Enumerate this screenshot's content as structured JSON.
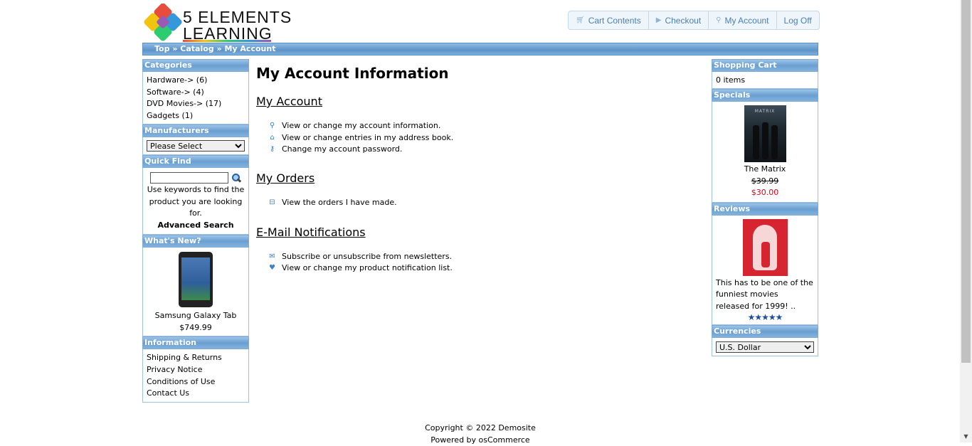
{
  "header": {
    "logo_line1": "5 ELEMENTS",
    "logo_line2": "LEARNING",
    "nav": {
      "cart_contents": "Cart Contents",
      "checkout": "Checkout",
      "my_account": "My Account",
      "log_off": "Log Off"
    }
  },
  "breadcrumb": {
    "top": "Top",
    "sep": "»",
    "catalog": "Catalog",
    "my_account": "My Account"
  },
  "left": {
    "categories": {
      "title": "Categories",
      "items": [
        "Hardware-> (6)",
        "Software-> (4)",
        "DVD Movies-> (17)",
        "Gadgets (1)"
      ]
    },
    "manufacturers": {
      "title": "Manufacturers",
      "selected": "Please Select"
    },
    "quick_find": {
      "title": "Quick Find",
      "help": "Use keywords to find the product you are looking for.",
      "advanced": "Advanced Search"
    },
    "whats_new": {
      "title": "What's New?",
      "product": "Samsung Galaxy Tab",
      "price": "$749.99"
    },
    "information": {
      "title": "Information",
      "items": [
        "Shipping & Returns",
        "Privacy Notice",
        "Conditions of Use",
        "Contact Us"
      ]
    }
  },
  "main": {
    "title": "My Account Information",
    "sections": [
      {
        "heading": "My Account",
        "items": [
          {
            "icon": "person-icon",
            "text": "View or change my account information."
          },
          {
            "icon": "home-icon",
            "text": "View or change entries in my address book."
          },
          {
            "icon": "key-icon",
            "text": "Change my account password."
          }
        ]
      },
      {
        "heading": "My Orders",
        "items": [
          {
            "icon": "cart-icon",
            "text": "View the orders I have made."
          }
        ]
      },
      {
        "heading": "E-Mail Notifications",
        "items": [
          {
            "icon": "envelope-icon",
            "text": "Subscribe or unsubscribe from newsletters."
          },
          {
            "icon": "heart-icon",
            "text": "View or change my product notification list."
          }
        ]
      }
    ]
  },
  "right": {
    "cart": {
      "title": "Shopping Cart",
      "items": "0 items"
    },
    "specials": {
      "title": "Specials",
      "poster_text": "MATRIX",
      "product": "The Matrix",
      "old_price": "$39.99",
      "new_price": "$30.00"
    },
    "reviews": {
      "title": "Reviews",
      "text": "This has to be one of the funniest movies released for 1999! ..",
      "stars": "★★★★★",
      "rating": 5
    },
    "currencies": {
      "title": "Currencies",
      "selected": "U.S. Dollar"
    }
  },
  "footer": {
    "copyright": "Copyright © 2022 Demosite",
    "powered": "Powered by osCommerce"
  },
  "colors": {
    "header_blue": "#5c93c8",
    "link_blue": "#4a7fb7",
    "price_red": "#e0001a"
  }
}
